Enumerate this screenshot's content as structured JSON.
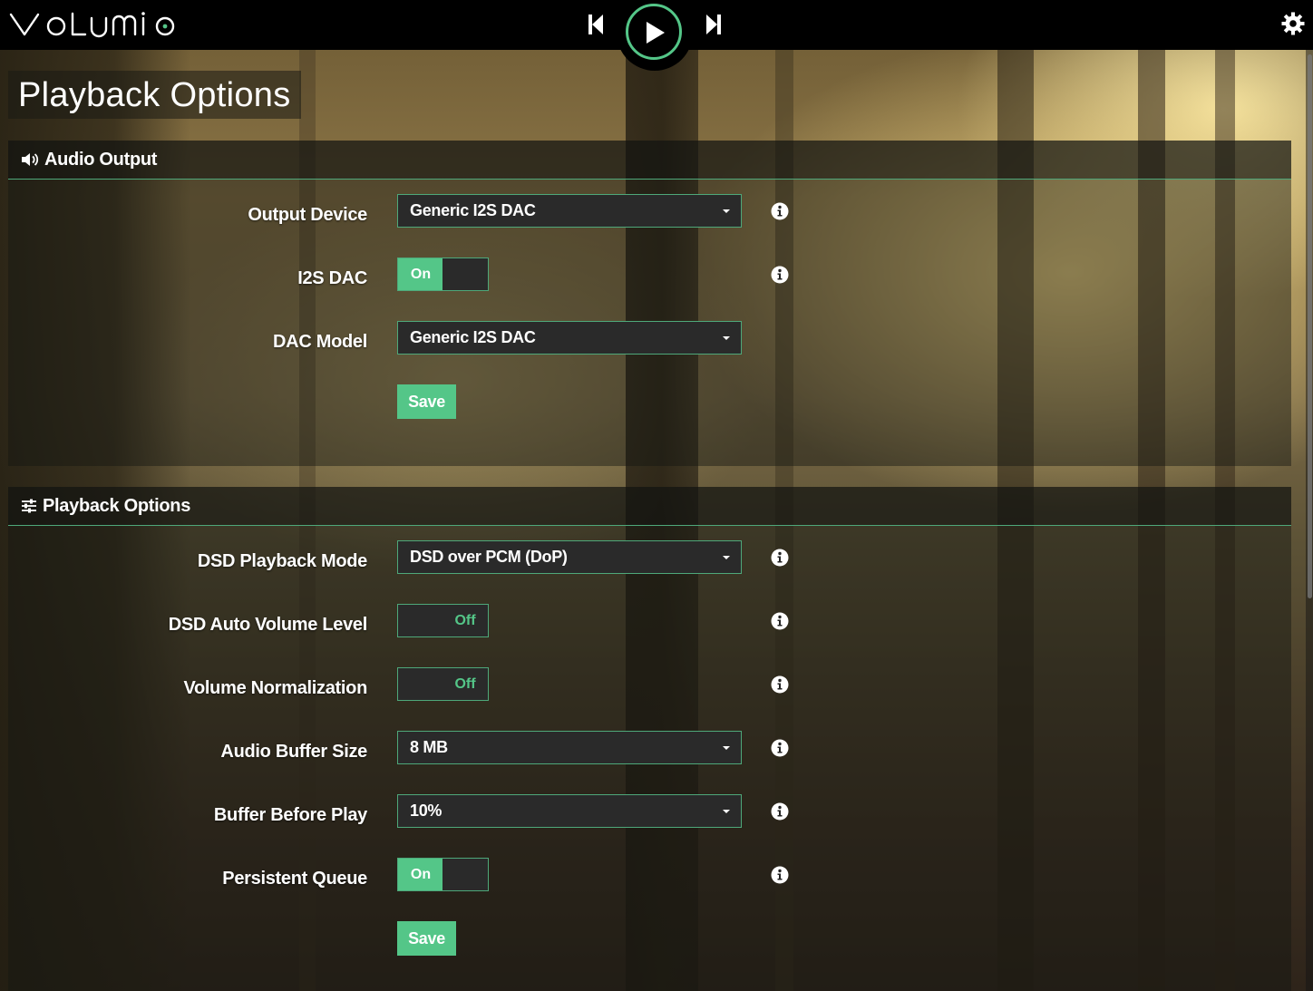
{
  "app": {
    "logo_text": "volumio",
    "accent_color": "#54c688"
  },
  "topbar": {
    "prev_icon": "skip-previous-icon",
    "play_icon": "play-icon",
    "next_icon": "skip-next-icon",
    "settings_icon": "gear-icon"
  },
  "page": {
    "title": "Playback Options"
  },
  "audio_output": {
    "header": "Audio Output",
    "header_icon": "speaker-icon",
    "rows": [
      {
        "label": "Output Device",
        "type": "select",
        "value": "Generic I2S DAC"
      },
      {
        "label": "I2S DAC",
        "type": "toggle",
        "state": "On"
      },
      {
        "label": "DAC Model",
        "type": "select",
        "value": "Generic I2S DAC"
      }
    ],
    "save_label": "Save"
  },
  "playback_options": {
    "header": "Playback Options",
    "header_icon": "sliders-icon",
    "rows": [
      {
        "label": "DSD Playback Mode",
        "type": "select",
        "value": "DSD over PCM (DoP)"
      },
      {
        "label": "DSD Auto Volume Level",
        "type": "toggle",
        "state": "Off"
      },
      {
        "label": "Volume Normalization",
        "type": "toggle",
        "state": "Off"
      },
      {
        "label": "Audio Buffer Size",
        "type": "select",
        "value": "8 MB"
      },
      {
        "label": "Buffer Before Play",
        "type": "select",
        "value": "10%"
      },
      {
        "label": "Persistent Queue",
        "type": "toggle",
        "state": "On"
      }
    ],
    "save_label": "Save"
  },
  "info_icon": "info-icon"
}
